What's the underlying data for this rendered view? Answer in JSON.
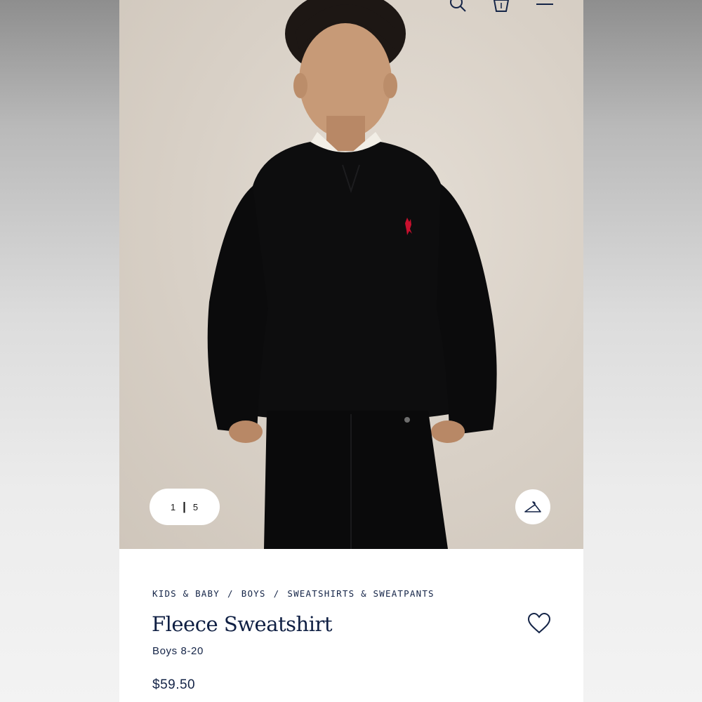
{
  "header": {
    "icons": [
      "search-icon",
      "shopping-bag-icon",
      "menu-icon"
    ]
  },
  "gallery": {
    "current": "1",
    "separator": "|",
    "total": "5",
    "hanger_icon": "hanger-icon",
    "logo_color": "#c8102e"
  },
  "breadcrumb": {
    "items": [
      "KIDS & BABY",
      "BOYS",
      "SWEATSHIRTS & SWEATPANTS"
    ],
    "separator": "/"
  },
  "product": {
    "title": "Fleece Sweatshirt",
    "subtitle": "Boys 8-20",
    "price": "$59.50",
    "wishlist_icon": "heart-icon"
  },
  "colors": {
    "brand_navy": "#0f1f43"
  }
}
